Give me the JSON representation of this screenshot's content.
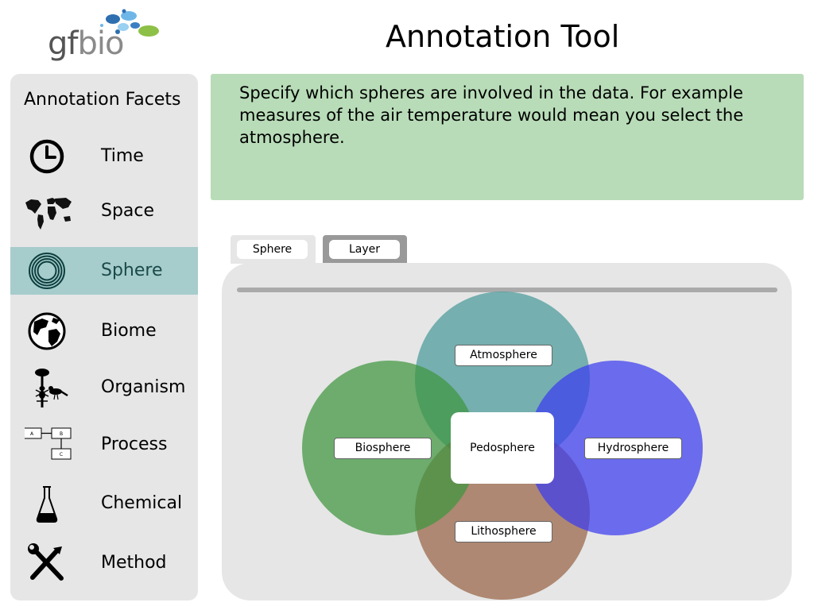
{
  "logo": {
    "text_gf": "gf",
    "text_bio": "bio"
  },
  "header": {
    "title": "Annotation Tool"
  },
  "sidebar": {
    "title": "Annotation Facets",
    "items": [
      {
        "label": "Time",
        "icon": "clock-icon"
      },
      {
        "label": "Space",
        "icon": "world-map-icon"
      },
      {
        "label": "Sphere",
        "icon": "concentric-rings-icon",
        "active": true
      },
      {
        "label": "Biome",
        "icon": "globe-icon"
      },
      {
        "label": "Organism",
        "icon": "organism-icon"
      },
      {
        "label": "Process",
        "icon": "process-flow-icon"
      },
      {
        "label": "Chemical",
        "icon": "flask-icon"
      },
      {
        "label": "Method",
        "icon": "tools-icon"
      }
    ],
    "active_color": "#a6cccc"
  },
  "info": {
    "text": "Specify which spheres are involved in the data. For example measures of the air temperature would mean you select the atmosphere."
  },
  "tabs": [
    {
      "label": "Sphere",
      "active": true
    },
    {
      "label": "Layer",
      "active": false
    }
  ],
  "spheres": {
    "atmosphere": {
      "label": "Atmosphere",
      "color": "#4a9a9a"
    },
    "biosphere": {
      "label": "Biosphere",
      "color": "#3f963f"
    },
    "hydrosphere": {
      "label": "Hydrosphere",
      "color": "#3b3bf0"
    },
    "lithosphere": {
      "label": "Lithosphere",
      "color": "#8b4d2a"
    },
    "pedosphere": {
      "label": "Pedosphere"
    }
  },
  "colors": {
    "info_bg": "#b8dcb8",
    "panel_bg": "#e6e6e6"
  }
}
